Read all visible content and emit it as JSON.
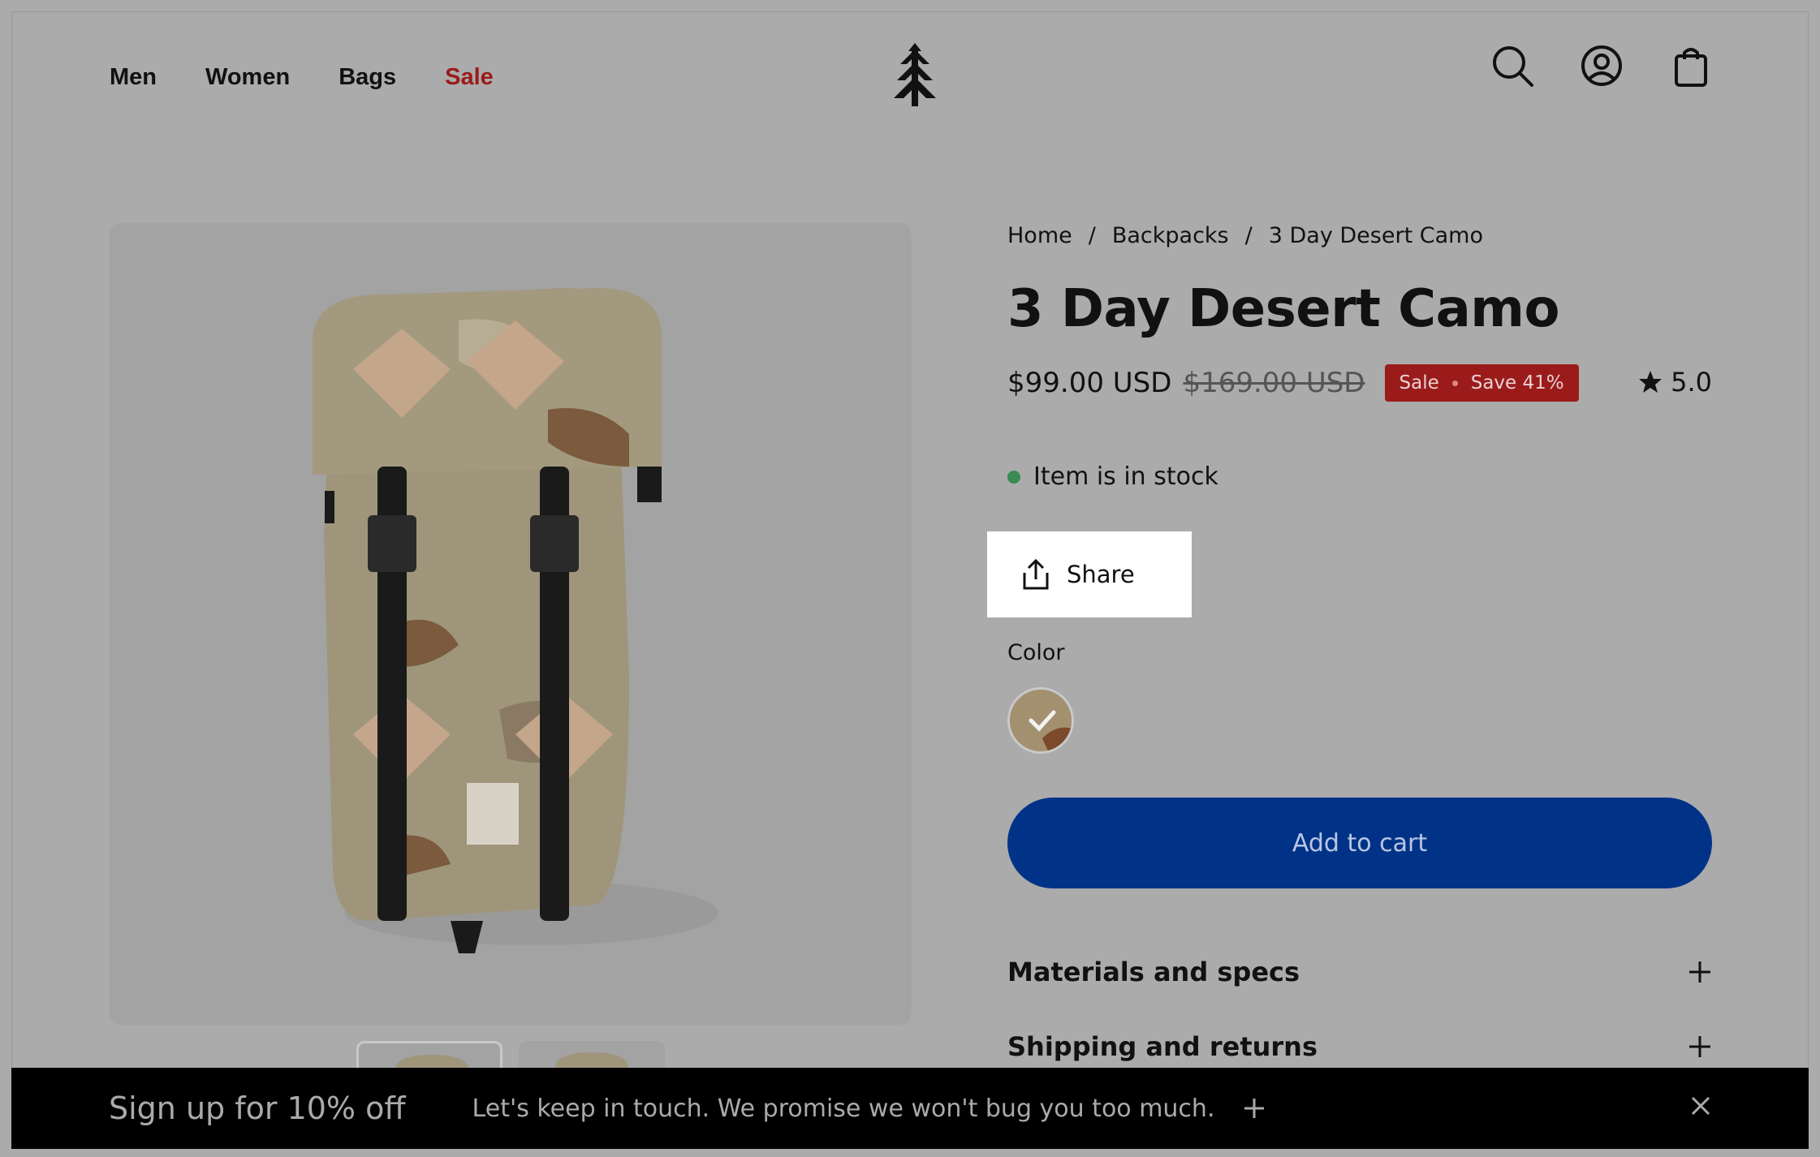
{
  "nav": {
    "items": [
      {
        "label": "Men"
      },
      {
        "label": "Women"
      },
      {
        "label": "Bags"
      },
      {
        "label": "Sale"
      }
    ]
  },
  "header": {
    "logo_icon": "tree-logo-icon",
    "icons": [
      "search-icon",
      "account-icon",
      "cart-bag-icon"
    ]
  },
  "breadcrumb": {
    "items": [
      "Home",
      "Backpacks",
      "3 Day Desert Camo"
    ],
    "separator": "/"
  },
  "product": {
    "title": "3 Day Desert Camo",
    "price": "$99.00 USD",
    "compare_price": "$169.00 USD",
    "badge_sale": "Sale",
    "badge_save": "Save 41%",
    "rating": "5.0",
    "stock_text": "Item is in stock",
    "share_label": "Share",
    "color_label": "Color",
    "add_to_cart": "Add to cart",
    "accordions": [
      "Materials and specs",
      "Shipping and returns"
    ]
  },
  "signup": {
    "title": "Sign up for 10% off",
    "message": "Let's keep in touch. We promise we won't bug you too much."
  },
  "colors": {
    "sale_red": "#9b1b1b",
    "primary_blue": "#003388",
    "stock_green": "#3a8a52"
  }
}
